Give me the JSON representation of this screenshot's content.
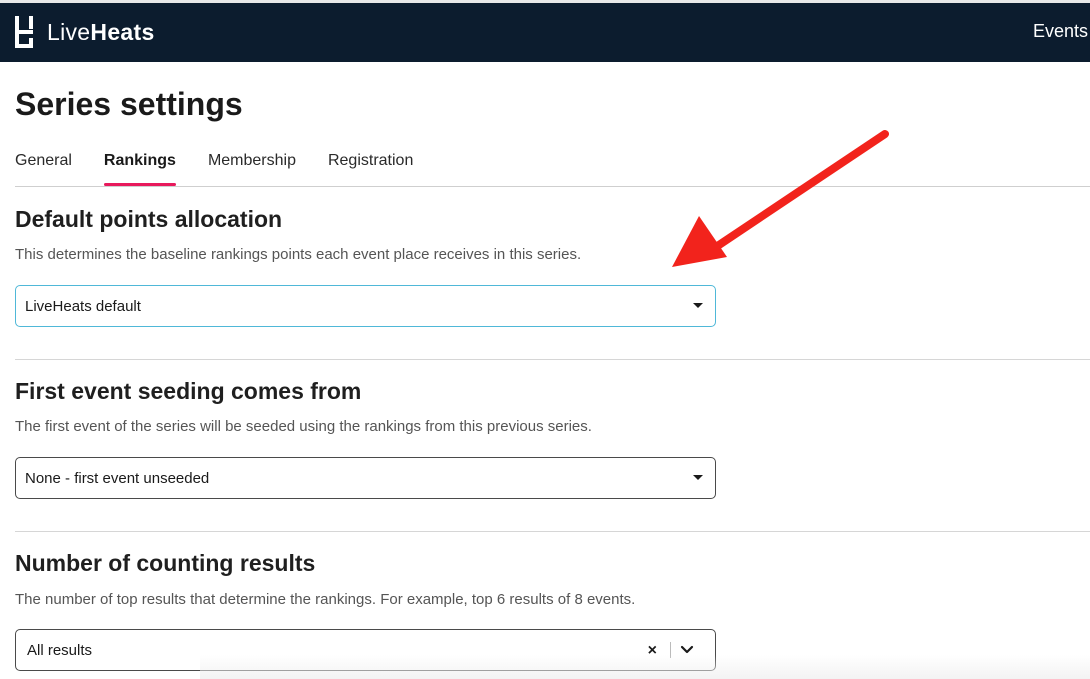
{
  "brand": {
    "name_light": "Live",
    "name_bold": "Heats"
  },
  "nav": {
    "events": "Events"
  },
  "page": {
    "title": "Series settings"
  },
  "tabs": [
    {
      "label": "General",
      "active": false
    },
    {
      "label": "Rankings",
      "active": true
    },
    {
      "label": "Membership",
      "active": false
    },
    {
      "label": "Registration",
      "active": false
    }
  ],
  "sections": {
    "points": {
      "title": "Default points allocation",
      "desc": "This determines the baseline rankings points each event place receives in this series.",
      "value": "LiveHeats default"
    },
    "seeding": {
      "title": "First event seeding comes from",
      "desc": "The first event of the series will be seeded using the rankings from this previous series.",
      "value": "None - first event unseeded"
    },
    "counting": {
      "title": "Number of counting results",
      "desc": "The number of top results that determine the rankings. For example, top 6 results of 8 events.",
      "value": "All results"
    }
  },
  "colors": {
    "topbar": "#0c1c2e",
    "tab_indicator": "#e8195c",
    "focus_border": "#4fb8d8",
    "arrow": "#f2231c"
  },
  "icons": {
    "clear": "×"
  }
}
